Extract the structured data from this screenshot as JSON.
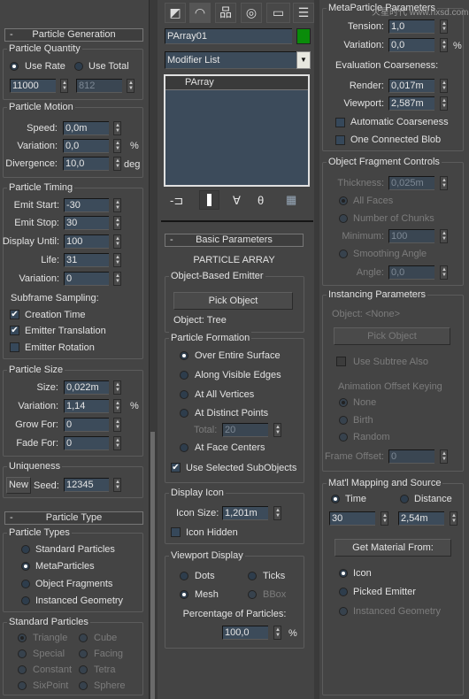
{
  "left": {
    "gen_header": "Particle Generation",
    "collapse": "-",
    "quantity": {
      "title": "Particle Quantity",
      "use_rate": "Use Rate",
      "use_total": "Use Total",
      "rate_value": "11000",
      "total_value": "812",
      "selected": "Use Rate"
    },
    "motion": {
      "title": "Particle Motion",
      "speed_label": "Speed:",
      "speed": "0,0m",
      "variation_label": "Variation:",
      "variation": "0,0",
      "pct": "%",
      "divergence_label": "Divergence:",
      "divergence": "10,0",
      "deg": "deg"
    },
    "timing": {
      "title": "Particle Timing",
      "emit_start_label": "Emit Start:",
      "emit_start": "-30",
      "emit_stop_label": "Emit Stop:",
      "emit_stop": "30",
      "display_until_label": "Display Until:",
      "display_until": "100",
      "life_label": "Life:",
      "life": "31",
      "variation_label": "Variation:",
      "variation": "0",
      "subframe": "Subframe Sampling:",
      "creation_time": "Creation Time",
      "emitter_translation": "Emitter Translation",
      "emitter_rotation": "Emitter Rotation",
      "checks": {
        "creation_time": true,
        "emitter_translation": true,
        "emitter_rotation": false
      }
    },
    "size": {
      "title": "Particle Size",
      "size_label": "Size:",
      "size": "0,022m",
      "variation_label": "Variation:",
      "variation": "1,14",
      "pct": "%",
      "grow_label": "Grow For:",
      "grow": "0",
      "fade_label": "Fade For:",
      "fade": "0"
    },
    "uniqueness": {
      "title": "Uniqueness",
      "new_button": "New",
      "seed_label": "Seed:",
      "seed": "12345"
    },
    "type_header": "Particle Type",
    "types": {
      "title": "Particle Types",
      "options": [
        "Standard Particles",
        "MetaParticles",
        "Object Fragments",
        "Instanced Geometry"
      ],
      "selected": "MetaParticles"
    },
    "standard": {
      "title": "Standard Particles",
      "options": [
        "Triangle",
        "Cube",
        "Special",
        "Facing",
        "Constant",
        "Tetra",
        "SixPoint",
        "Sphere"
      ],
      "selected": "Triangle",
      "disabled": true
    }
  },
  "middle": {
    "tabs": [
      "create-icon",
      "modify-icon",
      "hierarchy-icon",
      "motion-icon",
      "display-icon",
      "utilities-icon"
    ],
    "object_name": "PArray01",
    "object_color": "#0a8c0a",
    "modifier_list": "Modifier List",
    "stack": [
      "PArray"
    ],
    "basic_header": "Basic Parameters",
    "title": "PARTICLE ARRAY",
    "emitter": {
      "title": "Object-Based Emitter",
      "pick_button": "Pick Object",
      "object_label": "Object: Tree"
    },
    "formation": {
      "title": "Particle Formation",
      "over_surface": "Over Entire Surface",
      "visible_edges": "Along Visible Edges",
      "all_vertices": "At All Vertices",
      "distinct_points": "At Distinct Points",
      "total_label": "Total:",
      "total": "20",
      "face_centers": "At Face Centers",
      "use_selected": "Use Selected SubObjects",
      "selected": "Over Entire Surface",
      "use_selected_checked": true
    },
    "display_icon": {
      "title": "Display Icon",
      "size_label": "Icon Size:",
      "size": "1,201m",
      "hidden": "Icon Hidden",
      "hidden_checked": false
    },
    "viewport": {
      "title": "Viewport Display",
      "dots": "Dots",
      "ticks": "Ticks",
      "mesh": "Mesh",
      "bbox": "BBox",
      "selected": "Mesh",
      "pct_label": "Percentage of Particles:",
      "pct": "100,0",
      "pct_unit": "%"
    }
  },
  "right": {
    "watermark": "火星时代 www.hxsd.com",
    "meta": {
      "title": "MetaParticle Parameters",
      "tension_label": "Tension:",
      "tension": "1,0",
      "variation_label": "Variation:",
      "variation": "0,0",
      "pct": "%",
      "coarse": "Evaluation Coarseness:",
      "render_label": "Render:",
      "render": "0,017m",
      "viewport_label": "Viewport:",
      "viewport": "2,587m",
      "auto": "Automatic Coarseness",
      "blob": "One Connected Blob"
    },
    "fragment": {
      "title": "Object Fragment Controls",
      "thickness_label": "Thickness:",
      "thickness": "0,025m",
      "all_faces": "All Faces",
      "chunks": "Number of Chunks",
      "minimum_label": "Minimum:",
      "minimum": "100",
      "smoothing": "Smoothing Angle",
      "angle_label": "Angle:",
      "angle": "0,0",
      "selected": "All Faces"
    },
    "instancing": {
      "title": "Instancing Parameters",
      "object_label": "Object: <None>",
      "pick_button": "Pick Object",
      "subtree": "Use Subtree Also",
      "offset_keying": "Animation Offset Keying",
      "none": "None",
      "birth": "Birth",
      "random": "Random",
      "frame_offset_label": "Frame Offset:",
      "frame_offset": "0",
      "selected": "None"
    },
    "mapping": {
      "title": "Mat'l Mapping and Source",
      "time": "Time",
      "distance": "Distance",
      "time_value": "30",
      "distance_value": "2,54m",
      "selected": "Time",
      "get_button": "Get Material From:",
      "icon": "Icon",
      "picked_emitter": "Picked Emitter",
      "instanced_geometry": "Instanced Geometry",
      "source_selected": "Icon"
    }
  }
}
